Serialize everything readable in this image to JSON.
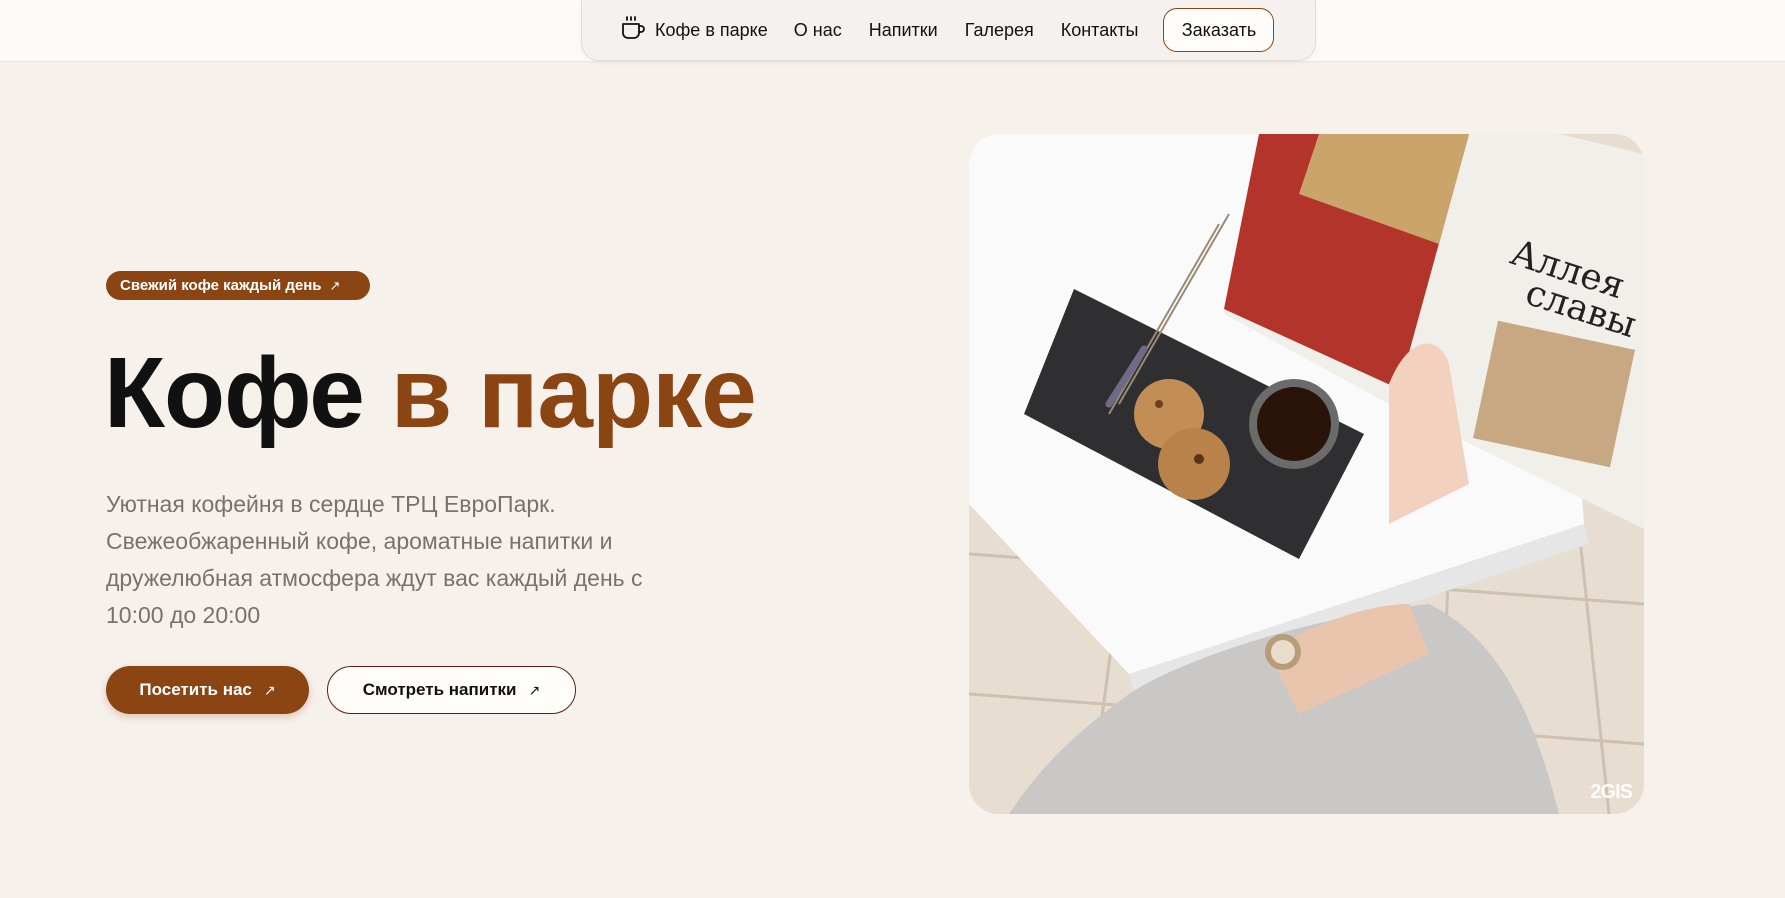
{
  "nav": {
    "logo_label": "Кофе в парке",
    "links": [
      "О нас",
      "Напитки",
      "Галерея",
      "Контакты"
    ],
    "order_button": "Заказать"
  },
  "hero": {
    "badge": "Свежий кофе каждый день",
    "title_part1": "Кофе",
    "title_part2": "в парке",
    "description": "Уютная кофейня в сердце ТРЦ ЕвроПарк. Свежеобжаренный кофе, ароматные напитки и дружелюбная атмосфера ждут вас каждый день с 10:00 до 20:00",
    "primary_button": "Посетить нас",
    "secondary_button": "Смотреть напитки",
    "photo_watermark": "2GIS"
  },
  "colors": {
    "accent": "#8b4513",
    "background": "#f7f1ec"
  },
  "icons": {
    "logo": "coffee-cup-icon",
    "arrow": "arrow-up-right-icon"
  }
}
